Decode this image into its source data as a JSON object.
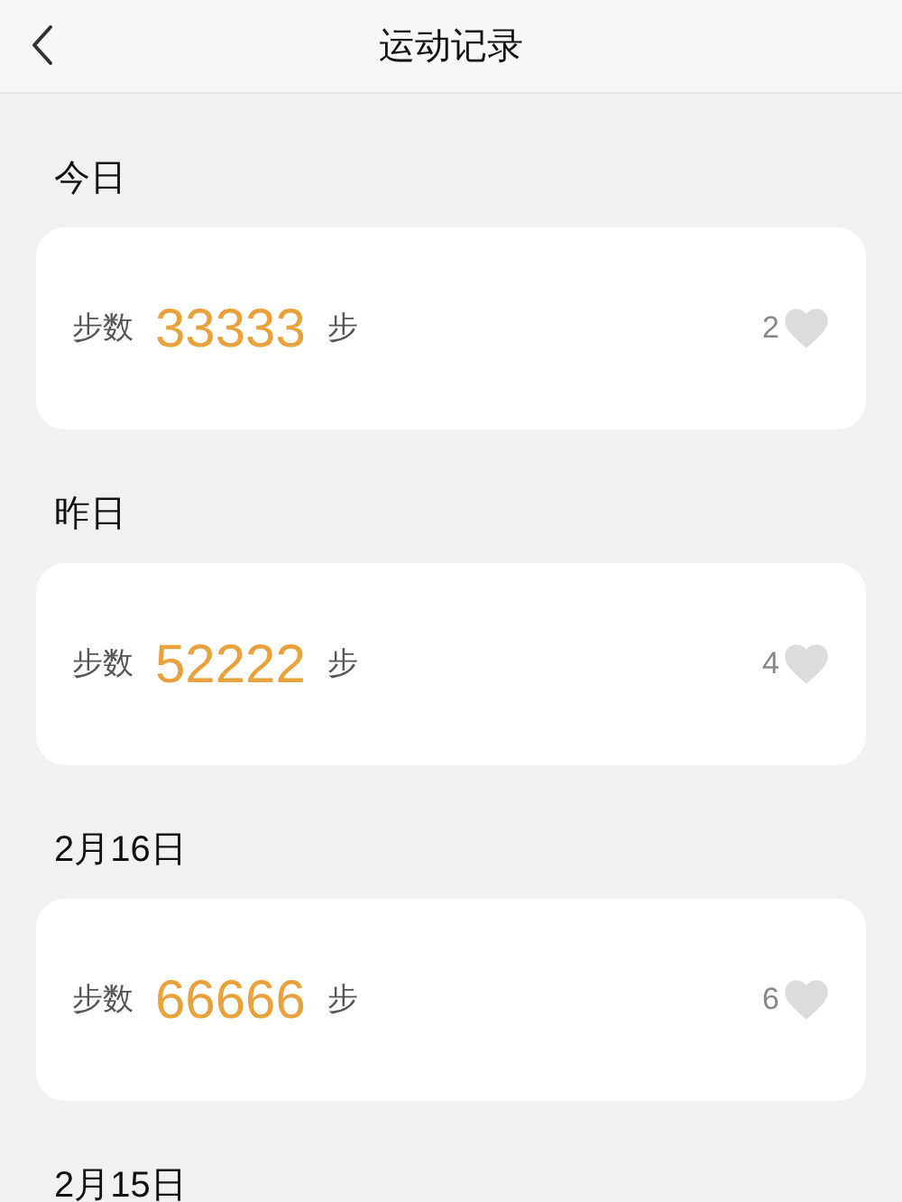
{
  "header": {
    "title": "运动记录"
  },
  "days": [
    {
      "date": "今日",
      "label": "步数",
      "steps": "33333",
      "unit": "步",
      "likes": "2",
      "liked": false
    },
    {
      "date": "昨日",
      "label": "步数",
      "steps": "52222",
      "unit": "步",
      "likes": "4",
      "liked": false
    },
    {
      "date": "2月16日",
      "label": "步数",
      "steps": "66666",
      "unit": "步",
      "likes": "6",
      "liked": false
    },
    {
      "date": "2月15日"
    }
  ]
}
